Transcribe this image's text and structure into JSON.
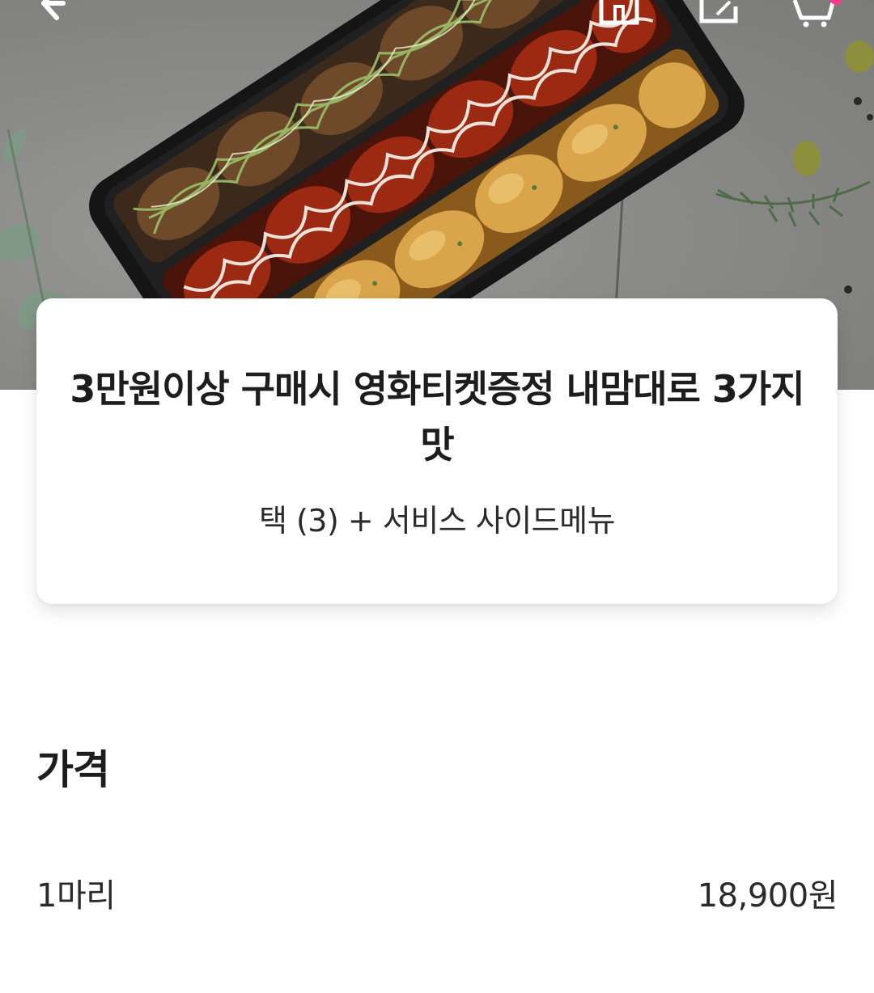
{
  "header": {
    "back_icon": "back-arrow-icon",
    "home_icon": "home-icon",
    "share_icon": "share-icon",
    "cart_icon": "cart-icon",
    "cart_badge_color": "#ff3c8c"
  },
  "hero": {
    "image": "chicken-tray-photo"
  },
  "product": {
    "title": "3만원이상 구매시 영화티켓증정 내맘대로 3가지맛",
    "subtitle": "택 (3) + 서비스 사이드메뉴"
  },
  "price_section": {
    "heading": "가격",
    "options": [
      {
        "label": "1마리",
        "price": "18,900원"
      }
    ]
  }
}
